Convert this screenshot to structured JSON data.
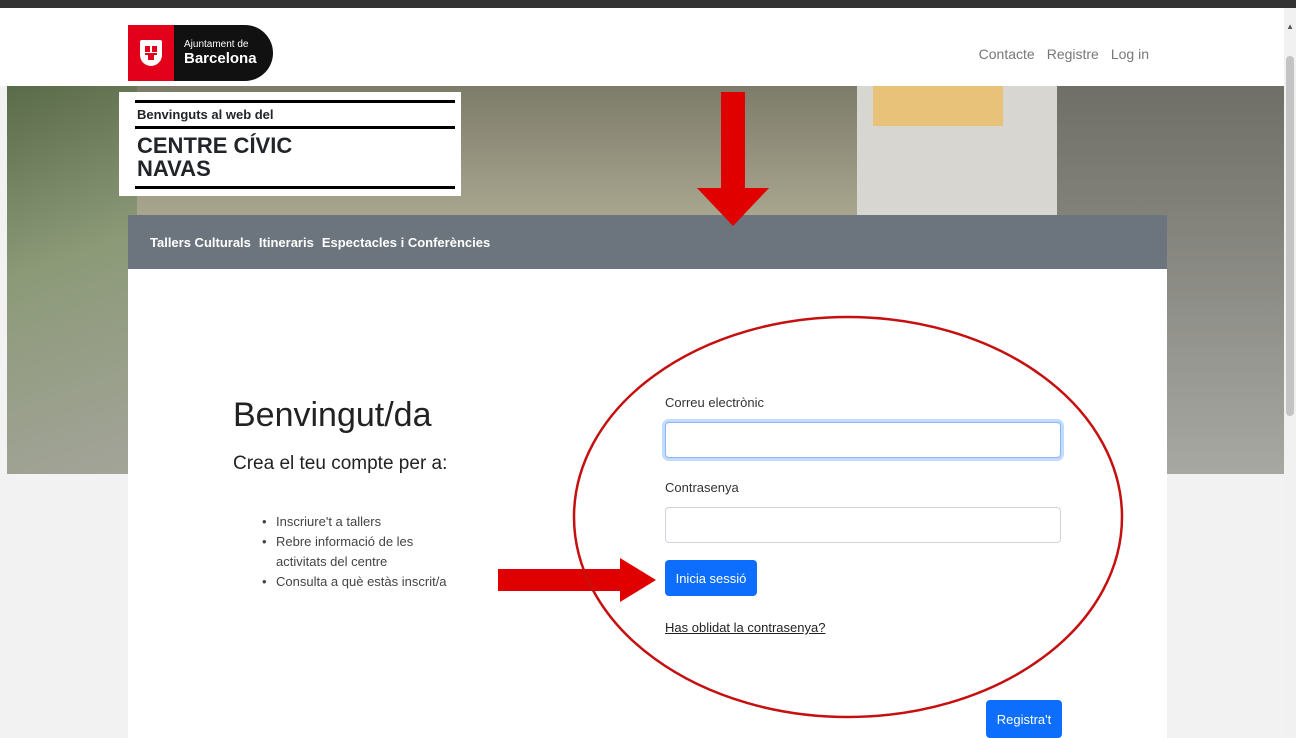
{
  "header": {
    "logo": {
      "line1": "Ajuntament de",
      "line2": "Barcelona"
    },
    "nav": [
      "Contacte",
      "Registre",
      "Log in"
    ]
  },
  "banner": {
    "small": "Benvinguts al web del",
    "line1": "CENTRE CÍVIC",
    "line2": "NAVAS"
  },
  "menu": [
    "Tallers Culturals",
    "Itineraris",
    "Espectacles i Conferències"
  ],
  "intro": {
    "title": "Benvingut/da",
    "subtitle": "Crea el teu compte per a:",
    "bullets": [
      "Inscriure't a tallers",
      "Rebre informació de les activitats del centre",
      "Consulta a què estàs inscrit/a"
    ]
  },
  "form": {
    "email_label": "Correu electrònic",
    "email_value": "",
    "password_label": "Contrasenya",
    "password_value": "",
    "login_button": "Inicia sessió",
    "forgot_link": "Has oblidat la contrasenya?"
  },
  "register_button": "Registra't",
  "colors": {
    "primary": "#0d6efd",
    "menu_bg": "#6c757d",
    "annotation": "#e00000",
    "logo_red": "#e2001a"
  }
}
